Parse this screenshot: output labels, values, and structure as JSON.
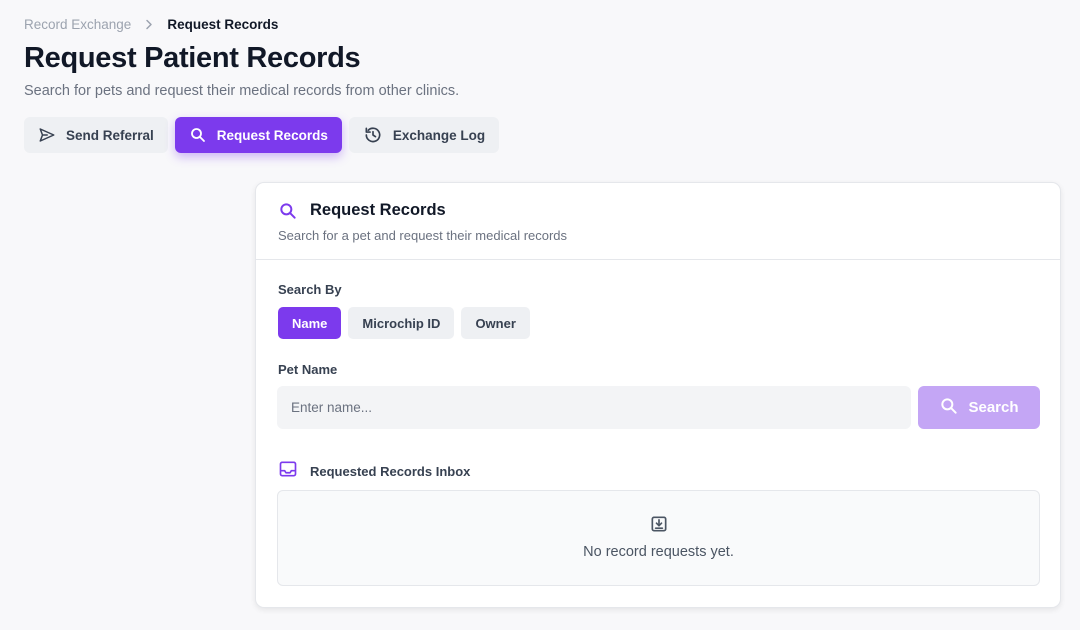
{
  "breadcrumb": {
    "parent": "Record Exchange",
    "current": "Request Records"
  },
  "page": {
    "title": "Request Patient Records",
    "subtitle": "Search for pets and request their medical records from other clinics."
  },
  "tabs": [
    {
      "label": "Send Referral",
      "icon": "send-icon",
      "active": false
    },
    {
      "label": "Request Records",
      "icon": "search-icon",
      "active": true
    },
    {
      "label": "Exchange Log",
      "icon": "history-icon",
      "active": false
    }
  ],
  "card": {
    "title": "Request Records",
    "description": "Search for a pet and request their medical records",
    "search_by_label": "Search By",
    "search_by_options": [
      {
        "label": "Name",
        "active": true
      },
      {
        "label": "Microchip ID",
        "active": false
      },
      {
        "label": "Owner",
        "active": false
      }
    ],
    "pet_name_label": "Pet Name",
    "pet_name_placeholder": "Enter name...",
    "pet_name_value": "",
    "search_button": "Search",
    "inbox_title": "Requested Records Inbox",
    "inbox_empty": "No record requests yet."
  },
  "colors": {
    "accent": "#7c3aed",
    "accent_disabled": "#c4a6f5",
    "background": "#f8f8fa"
  }
}
